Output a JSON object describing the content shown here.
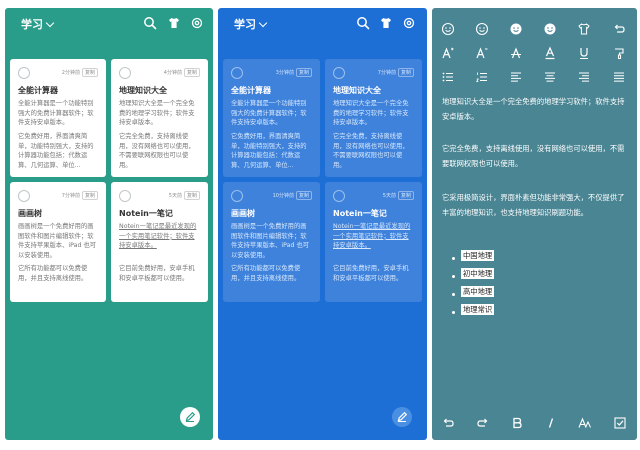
{
  "screens": {
    "green": {
      "title": "学习",
      "colors": {
        "background": "#2a9d8a"
      }
    },
    "blue": {
      "title": "学习",
      "colors": {
        "background": "#1d6fd6"
      }
    },
    "editor": {
      "colors": {
        "background": "#4a8593"
      }
    }
  },
  "icons": {
    "header": [
      "search-icon",
      "shirt-icon",
      "settings-icon"
    ],
    "fab": "pen-icon",
    "format_row1": [
      "smile-icon",
      "smile-icon",
      "smile-icon",
      "smile-icon",
      "shirt-icon",
      "undo-icon"
    ],
    "format_row2": [
      "font-size-increase-icon",
      "font-size-decrease-icon",
      "strikethrough-icon",
      "text-color-icon",
      "underline-icon",
      "paint-icon"
    ],
    "format_row3": [
      "bulleted-list-icon",
      "numbered-list-icon",
      "align-left-icon",
      "align-center-icon",
      "align-right-icon",
      "justify-icon"
    ],
    "bottom_bar": [
      "undo-icon",
      "redo-icon",
      "bold-icon",
      "italic-icon",
      "font-size-icon",
      "checkbox-icon"
    ]
  },
  "green_cards": [
    {
      "meta": "2分钟前",
      "tag": "复制",
      "title": "全能计算器",
      "p1": "全能计算器是一个功能特别强大的免费计算器软件；软件支持安卓版本。",
      "p2": "它免费好用，界面清爽简单，功能特别强大，支持的计算器功能包括：代数运算、几何运算、单位..."
    },
    {
      "meta": "4分钟前",
      "tag": "复制",
      "title": "地理知识大全",
      "p1": "地理知识大全是一个完全免费的地理学习软件；软件支持安卓版本。",
      "p2": "它完全免费，支持离线使用，没有网络也可以使用，不需要联网权限也可以使用。"
    },
    {
      "meta": "7分钟前",
      "tag": "复制",
      "title": "画画树",
      "p1": "画画树是一个免费好用的画图软件和图片编辑软件；软件支持苹果版本、iPad 也可以安装使用。",
      "p2": "它所有功能都可以免费使用，并且支持离线使用。"
    },
    {
      "meta": "5天前",
      "tag": "复制",
      "title": "Notein一笔记",
      "p1": "Notein一笔记是最近发现的一个实用笔记软件；软件支持安卓版本。",
      "p2": "它目前免费好用，安卓手机和安卓平板都可以使用。"
    }
  ],
  "blue_cards": [
    {
      "meta": "3分钟前",
      "tag": "复制",
      "title": "全能计算器",
      "p1": "全能计算器是一个功能特别强大的免费计算器软件；软件支持安卓版本。",
      "p2": "它免费好用，界面清爽简单，功能特别强大，支持的计算器功能包括：代数运算、几何运算、单位..."
    },
    {
      "meta": "7分钟前",
      "tag": "复制",
      "title": "地理知识大全",
      "p1": "地理知识大全是一个完全免费的地理学习软件；软件支持安卓版本。",
      "p2": "它完全免费，支持离线使用，没有网络也可以使用，不需要联网权限也可以使用。"
    },
    {
      "meta": "10分钟前",
      "tag": "复制",
      "title": "画画树",
      "p1": "画画树是一个免费好用的画图软件和图片编辑软件；软件支持苹果版本、iPad 也可以安装使用。",
      "p2": "它所有功能都可以免费使用，并且支持离线使用。"
    },
    {
      "meta": "5天前",
      "tag": "复制",
      "title": "Notein一笔记",
      "p1": "Notein一笔记是最近发现的一个实用笔记软件；软件支持安卓版本。",
      "p2": "它目前免费好用，安卓手机和安卓平板都可以使用。"
    }
  ],
  "editor": {
    "paragraphs": [
      "地理知识大全是一个完全免费的地理学习软件；软件支持安卓版本。",
      "它完全免费，支持离线使用，没有网络也可以使用，不需要联网权限也可以使用。",
      "它采用极简设计，界面朴素但功能非常强大，不仅提供了丰富的地理知识，也支持地理知识刷题功能。"
    ],
    "bullets": [
      "中国地理",
      "初中地理",
      "高中地理",
      "地理常识"
    ]
  }
}
